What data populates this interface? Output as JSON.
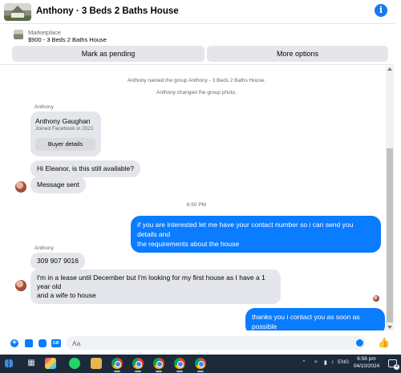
{
  "header": {
    "title": "Anthony · 3 Beds 2 Baths House",
    "info_icon": "info-icon"
  },
  "marketplace": {
    "label": "Marketplace",
    "listing": "$900 - 3 Beds 2 Baths House",
    "pending_button": "Mark as pending",
    "more_button": "More options"
  },
  "chat": {
    "system_messages": [
      "Anthony named the group Anthony - 3 Beds 2 Baths House.",
      "Anthony changed the group photo."
    ],
    "sender_name_1": "Anthony",
    "profile_card": {
      "name": "Anthony Gaughan",
      "joined": "Joined Facebook in 2021",
      "button": "Buyer details"
    },
    "incoming_1": "Hi Eleanor, is this still available?",
    "incoming_2": "Message sent",
    "timestamp": "6:50 PM",
    "outgoing_1_line1": "if you are interested let me have your contact number so i can send you details and",
    "outgoing_1_line2": "the requirements about the house",
    "sender_name_2": "Anthony",
    "incoming_3": "309 907 9016",
    "incoming_4_line1": "I'm in a lease until December but I'm looking for my first house as I have a 1 year old",
    "incoming_4_line2": "and a wife to house",
    "outgoing_2": "thanks you i contact you as soon as possible"
  },
  "composer": {
    "placeholder": "Aa",
    "plus_symbol": "+"
  },
  "taskbar": {
    "language": "ENG",
    "time": "6:56 pm",
    "date": "04/10/2024",
    "notification_count": "4"
  },
  "colors": {
    "accent": "#0a7cff",
    "bubble_incoming": "#e4e6eb",
    "taskbar": "#1c2a3a"
  }
}
